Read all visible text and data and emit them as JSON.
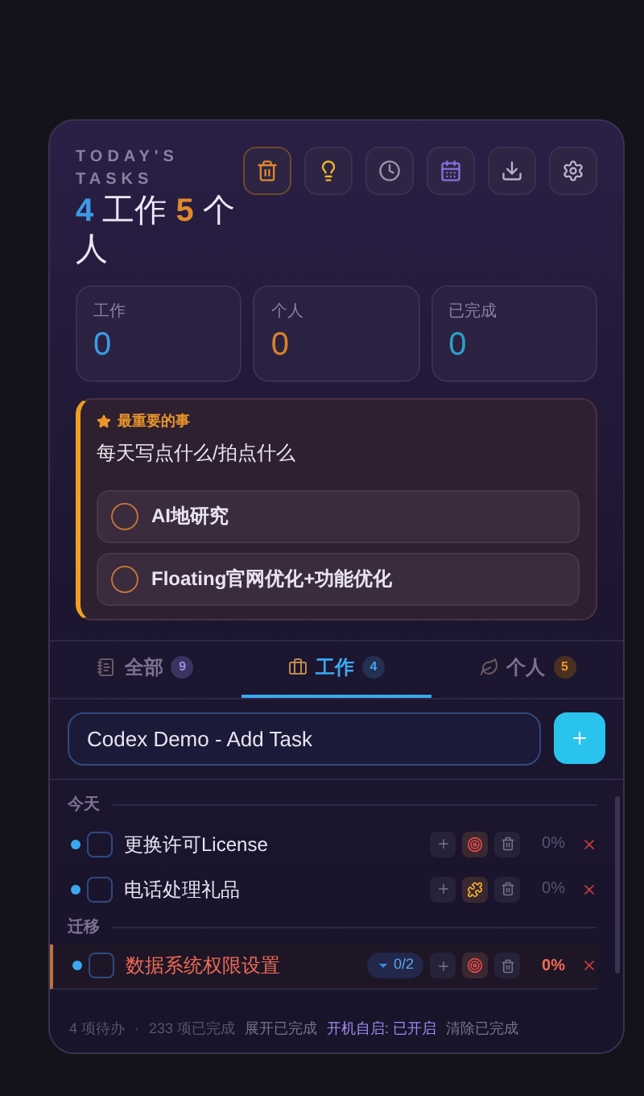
{
  "header": {
    "title": "TODAY'S TASKS",
    "work_count": "4",
    "work_label": "工作",
    "personal_count": "5",
    "personal_label": "个人",
    "tools": [
      {
        "kind": "trash",
        "active": true
      },
      {
        "kind": "bulb",
        "active": false
      },
      {
        "kind": "clock",
        "active": false
      },
      {
        "kind": "calendar",
        "active": false
      },
      {
        "kind": "download",
        "active": false
      },
      {
        "kind": "settings",
        "active": false
      }
    ]
  },
  "stats": [
    {
      "label": "工作",
      "value": "0",
      "color": "#3b9be6"
    },
    {
      "label": "个人",
      "value": "0",
      "color": "#d9822b"
    },
    {
      "label": "已完成",
      "value": "0",
      "color": "#2f9fc8"
    }
  ],
  "important": {
    "label": "最重要的事",
    "text": "每天写点什么/拍点什么",
    "items": [
      {
        "text": "AI地研究",
        "checked": false
      },
      {
        "text": "Floating官网优化+功能优化",
        "checked": false
      }
    ]
  },
  "tabs": [
    {
      "kind": "notebook",
      "label": "全部",
      "count": "9",
      "selected": false
    },
    {
      "kind": "briefcase",
      "label": "工作",
      "count": "4",
      "selected": true
    },
    {
      "kind": "leaf",
      "label": "个人",
      "count": "5",
      "selected": false
    }
  ],
  "input": {
    "value": "Codex Demo - Add Task"
  },
  "sections": [
    {
      "title": "今天",
      "tasks": [
        {
          "title": "更换许可License",
          "kind": "target",
          "percent": "0%",
          "overdue": false,
          "checked": false
        },
        {
          "title": "电话处理礼品",
          "kind": "puzzle",
          "percent": "0%",
          "overdue": false,
          "checked": false
        }
      ]
    },
    {
      "title": "迁移",
      "tasks": [
        {
          "title": "数据系统权限设置",
          "kind": "target",
          "percent": "0%",
          "overdue": true,
          "checked": false,
          "subtasks": "0/2"
        }
      ]
    }
  ],
  "footer": {
    "pending": "4 项待办",
    "separator": "·",
    "done": "233 项已完成",
    "actions": [
      {
        "label": "展开已完成",
        "highlighted": false
      },
      {
        "label": "开机自启: 已开启",
        "highlighted": true
      },
      {
        "label": "清除已完成",
        "highlighted": false
      }
    ]
  }
}
